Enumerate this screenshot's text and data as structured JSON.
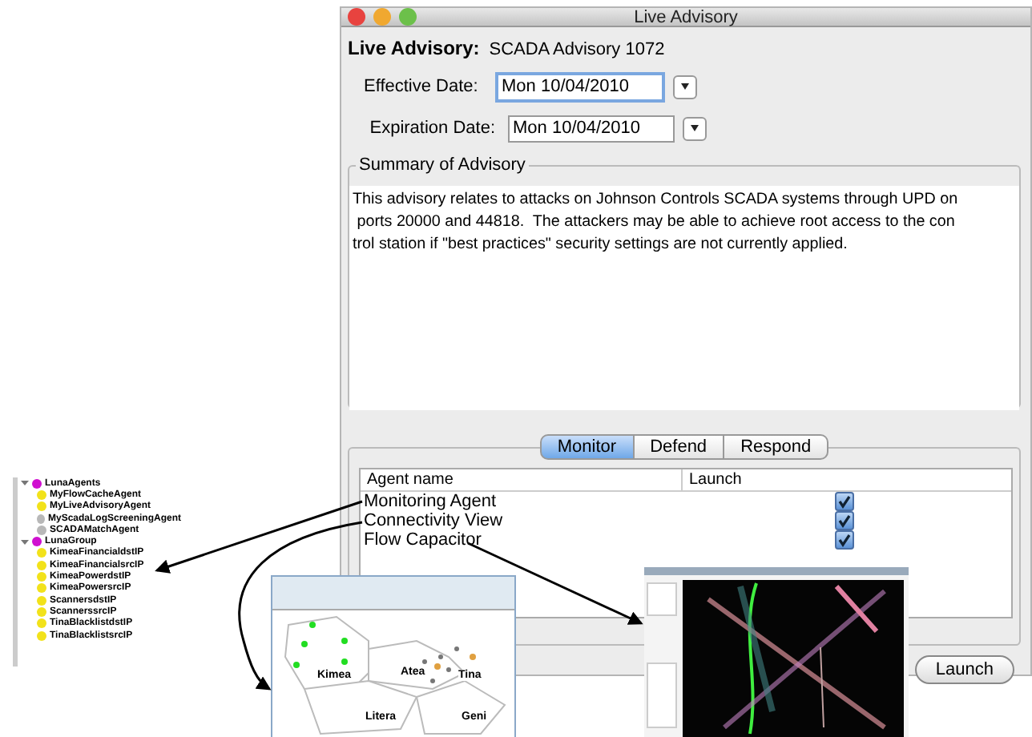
{
  "window": {
    "title": "Live Advisory"
  },
  "advisory": {
    "label": "Live Advisory:",
    "value": "SCADA Advisory 1072"
  },
  "fields": [
    {
      "label": "Effective Date:",
      "value": "Mon 10/04/2010",
      "focused": true
    },
    {
      "label": "Expiration Date:",
      "value": "Mon 10/04/2010",
      "focused": false
    }
  ],
  "summary": {
    "title": "Summary of Advisory",
    "lines": [
      "This advisory relates to attacks on Johnson Controls SCADA systems through UPD on",
      " ports 20000 and 44818.  The attackers may be able to achieve root access to the con",
      "trol station if \"best practices\" security settings are not currently applied."
    ]
  },
  "tabs": [
    {
      "label": "Monitor",
      "selected": true
    },
    {
      "label": "Defend",
      "selected": false
    },
    {
      "label": "Respond",
      "selected": false
    }
  ],
  "table": {
    "columns": [
      "Agent name",
      "Launch"
    ],
    "rows": [
      {
        "name": "Monitoring Agent",
        "launch": true
      },
      {
        "name": "Connectivity View",
        "launch": true
      },
      {
        "name": "Flow Capacitor",
        "launch": true
      }
    ]
  },
  "launch_button": "Launch",
  "tree": [
    {
      "label": "LunaAgents",
      "expanded": true,
      "children": [
        {
          "label": "MyFlowCacheAgent",
          "color": "#f2e21a"
        },
        {
          "label": "MyLiveAdvisoryAgent",
          "color": "#f2e21a"
        },
        {
          "label": "MyScadaLogScreeningAgent",
          "color": "#b8b8b8"
        },
        {
          "label": "SCADAMatchAgent",
          "color": "#b8b8b8"
        }
      ]
    },
    {
      "label": "LunaGroup",
      "expanded": true,
      "children": [
        {
          "label": "KimeaFinancialdstIP",
          "color": "#f2e21a"
        },
        {
          "label": "KimeaFinancialsrcIP",
          "color": "#f2e21a"
        },
        {
          "label": "KimeaPowerdstIP",
          "color": "#f2e21a"
        },
        {
          "label": "KimeaPowersrcIP",
          "color": "#f2e21a"
        },
        {
          "label": "ScannersdstIP",
          "color": "#f2e21a"
        },
        {
          "label": "ScannerssrcIP",
          "color": "#f2e21a"
        },
        {
          "label": "TinaBlacklistdstIP",
          "color": "#f2e21a"
        },
        {
          "label": "TinaBlacklistsrcIP",
          "color": "#f2e21a"
        }
      ]
    }
  ],
  "map": {
    "regions": [
      "Kimea",
      "Atea",
      "Tina",
      "Litera",
      "Geni"
    ]
  }
}
